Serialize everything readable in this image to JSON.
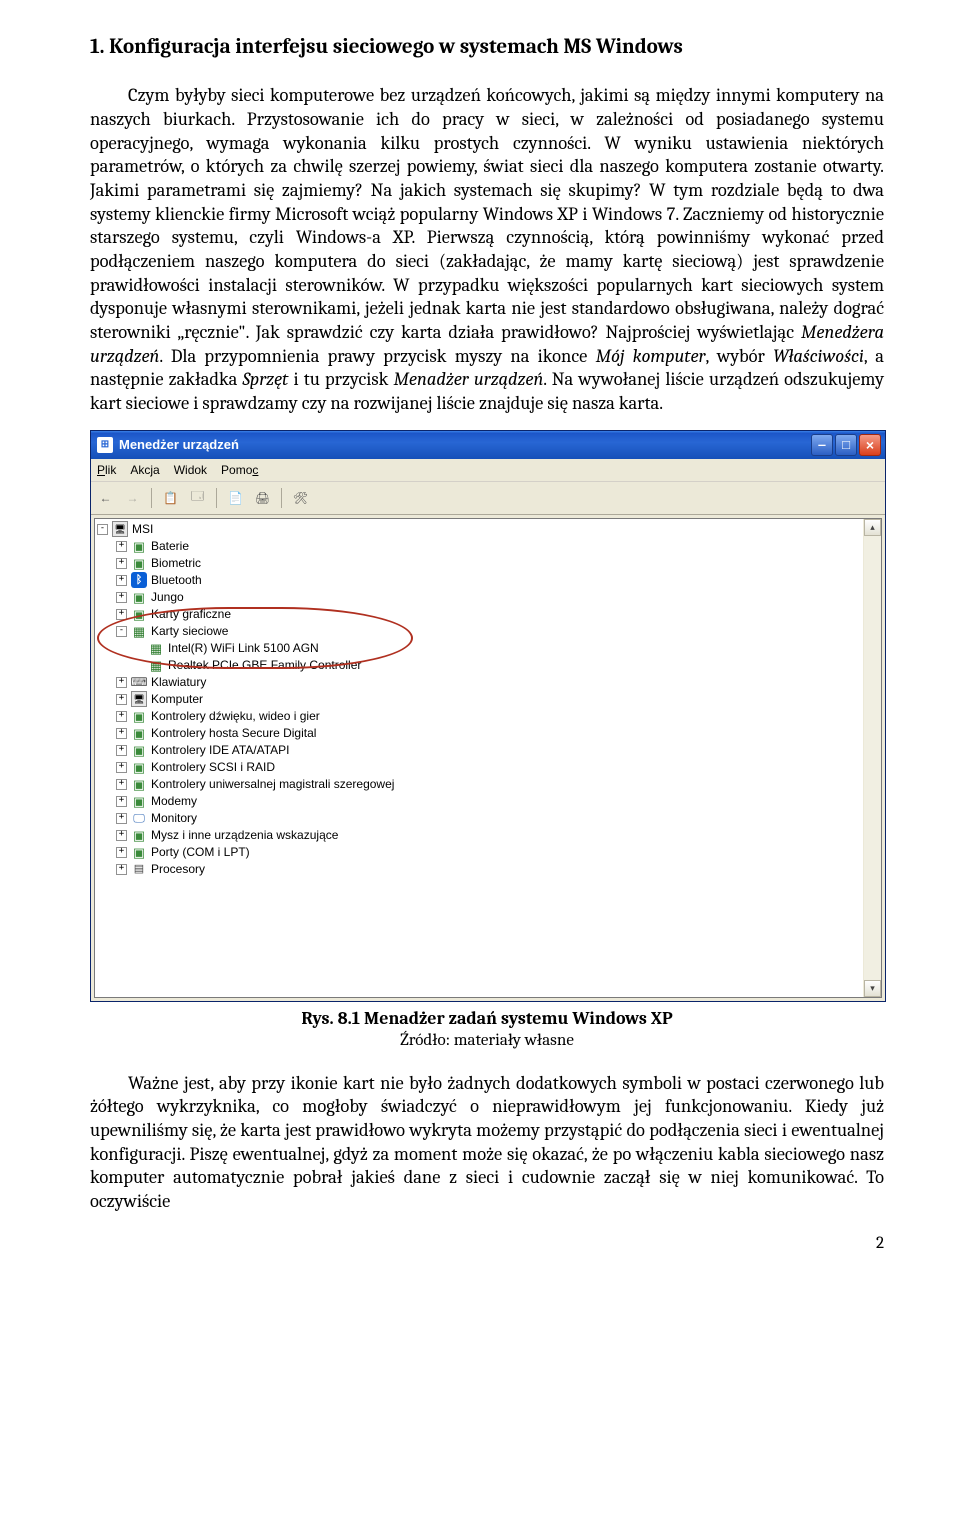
{
  "heading": "1.   Konfiguracja interfejsu sieciowego w systemach MS Windows",
  "para1_part1": "Czym byłyby sieci komputerowe bez urządzeń końcowych, jakimi są między innymi komputery na naszych biurkach. Przystosowanie ich do pracy w sieci, w zależności od posiadanego systemu operacyjnego, wymaga wykonania kilku prostych czynności. W wyniku ustawienia niektórych parametrów, o których za chwilę szerzej powiemy, świat sieci dla naszego komputera zostanie otwarty. Jakimi parametrami się zajmiemy? Na jakich systemach się skupimy? W tym rozdziale będą to dwa systemy klienckie firmy Microsoft wciąż popularny Windows XP i Windows 7. Zaczniemy od historycznie starszego systemu, czyli Windows-a XP. Pierwszą czynnością, którą powinniśmy wykonać przed podłączeniem naszego komputera do sieci (zakładając, że mamy kartę sieciową) jest sprawdzenie prawidłowości instalacji sterowników. W przypadku większości popularnych kart sieciowych system dysponuje własnymi sterownikami, jeżeli jednak karta nie jest standardowo obsługiwana, należy dograć sterowniki „ręcznie\". Jak sprawdzić czy karta działa prawidłowo? Najprościej wyświetlając ",
  "para1_em1": "Menedżera urządzeń",
  "para1_part2": ". Dla przypomnienia prawy przycisk myszy na ikonce ",
  "para1_em2": "Mój komputer",
  "para1_part3": ", wybór ",
  "para1_em3": "Właściwości",
  "para1_part4": ", a następnie zakładka ",
  "para1_em4": "Sprzęt",
  "para1_part5": " i tu przycisk ",
  "para1_em5": "Menadżer urządzeń",
  "para1_part6": ". Na wywołanej liście urządzeń odszukujemy kart sieciowe i sprawdzamy czy na rozwijanej liście znajduje się nasza karta.",
  "window": {
    "title": "Menedżer urządzeń",
    "menu": {
      "file": "Plik",
      "action": "Akcja",
      "view": "Widok",
      "help": "Pomoc"
    },
    "root": "MSI",
    "items": [
      {
        "exp": "+",
        "icon": "dev",
        "label": "Baterie"
      },
      {
        "exp": "+",
        "icon": "dev",
        "label": "Biometric"
      },
      {
        "exp": "+",
        "icon": "bt",
        "label": "Bluetooth"
      },
      {
        "exp": "+",
        "icon": "dev",
        "label": "Jungo"
      },
      {
        "exp": "+",
        "icon": "dev",
        "label": "Karty graficzne"
      },
      {
        "exp": "-",
        "icon": "net",
        "label": "Karty sieciowe",
        "children": [
          {
            "icon": "net",
            "label": "Intel(R) WiFi Link 5100 AGN"
          },
          {
            "icon": "net",
            "label": "Realtek PCIe GBE Family Controller"
          }
        ]
      },
      {
        "exp": "+",
        "icon": "kb",
        "label": "Klawiatury"
      },
      {
        "exp": "+",
        "icon": "pc",
        "label": "Komputer"
      },
      {
        "exp": "+",
        "icon": "dev",
        "label": "Kontrolery dźwięku, wideo i gier"
      },
      {
        "exp": "+",
        "icon": "dev",
        "label": "Kontrolery hosta Secure Digital"
      },
      {
        "exp": "+",
        "icon": "dev",
        "label": "Kontrolery IDE ATA/ATAPI"
      },
      {
        "exp": "+",
        "icon": "dev",
        "label": "Kontrolery SCSI i RAID"
      },
      {
        "exp": "+",
        "icon": "dev",
        "label": "Kontrolery uniwersalnej magistrali szeregowej"
      },
      {
        "exp": "+",
        "icon": "dev",
        "label": "Modemy"
      },
      {
        "exp": "+",
        "icon": "mon",
        "label": "Monitory"
      },
      {
        "exp": "+",
        "icon": "dev",
        "label": "Mysz i inne urządzenia wskazujące"
      },
      {
        "exp": "+",
        "icon": "dev",
        "label": "Porty (COM i LPT)"
      },
      {
        "exp": "+",
        "icon": "cpu",
        "label": "Procesory"
      }
    ]
  },
  "caption_bold": "Rys. 8.1 Menadżer zadań systemu Windows XP",
  "caption_sub": "Źródło: materiały własne",
  "para2": "Ważne jest, aby przy ikonie kart nie było żadnych dodatkowych symboli w postaci czerwonego lub żółtego wykrzyknika, co mogłoby świadczyć o nieprawidłowym jej funkcjonowaniu. Kiedy już upewniliśmy się, że karta jest prawidłowo wykryta możemy przystąpić do podłączenia sieci i ewentualnej konfiguracji. Piszę ewentualnej, gdyż za moment może się okazać, że po włączeniu kabla sieciowego nasz komputer automatycznie pobrał jakieś dane z sieci i cudownie zaczął się w niej komunikować. To oczywiście",
  "page_number": "2"
}
